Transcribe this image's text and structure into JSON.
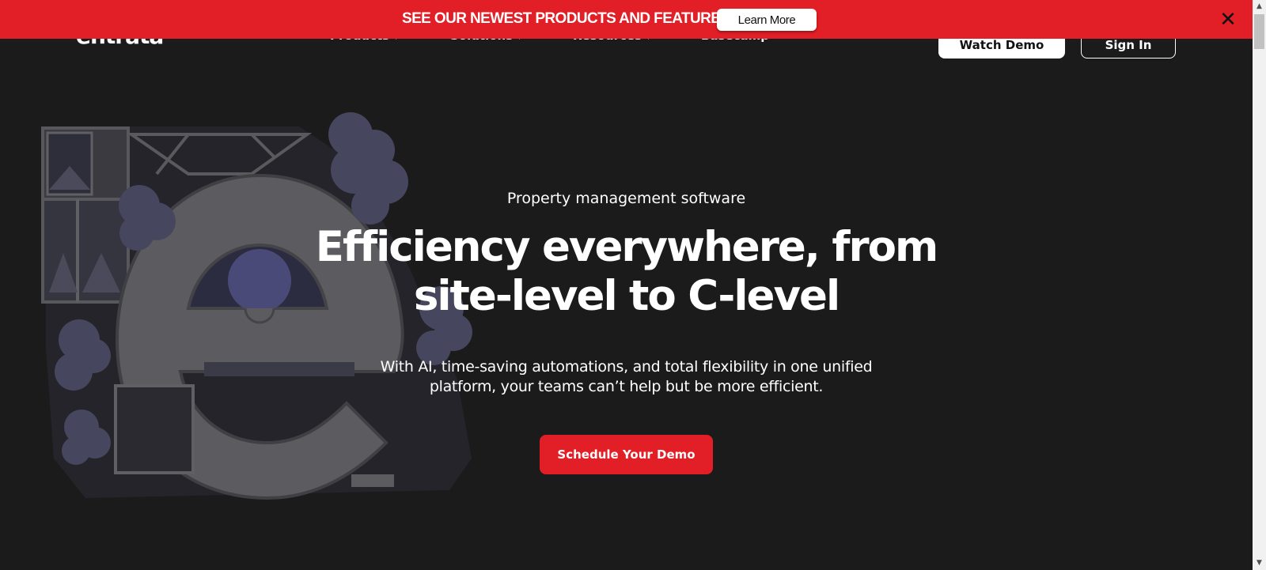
{
  "banner": {
    "text": "SEE OUR NEWEST PRODUCTS AND FEATURES",
    "button_label": "Learn More",
    "close_glyph": "✕",
    "background_color": "#e21f26"
  },
  "header": {
    "logo_text": "entrata",
    "nav": [
      {
        "label": "Products",
        "has_dropdown": true
      },
      {
        "label": "Solutions",
        "has_dropdown": true
      },
      {
        "label": "Resources",
        "has_dropdown": true
      },
      {
        "label": "Basecamp",
        "has_dropdown": false
      }
    ],
    "watch_demo_label": "Watch Demo",
    "sign_in_label": "Sign In"
  },
  "hero": {
    "eyebrow": "Property management software",
    "title_line1": "Efficiency everywhere, from",
    "title_line2": "site-level to C-level",
    "subtitle": "With AI, time-saving automations, and total flexibility in one unified platform, your teams can’t help but be more efficient.",
    "cta_label": "Schedule Your Demo",
    "cta_color": "#e21f26"
  },
  "icons": {
    "close": "close-icon",
    "chevron": "chevron-down-icon",
    "illustration": "building-e-illustration"
  }
}
